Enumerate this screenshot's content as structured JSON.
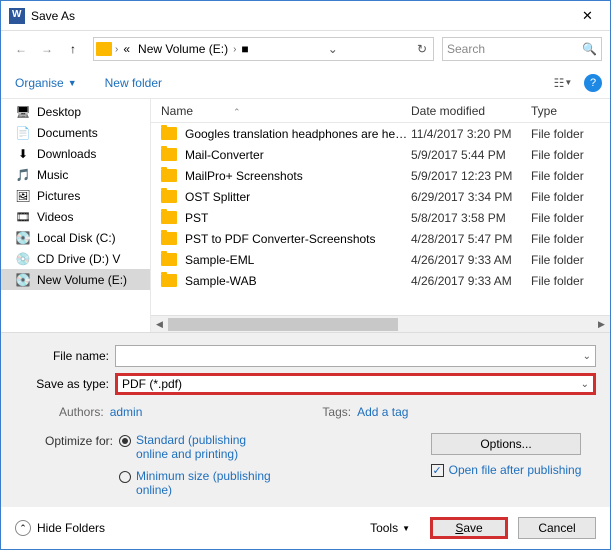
{
  "title": "Save As",
  "nav": {
    "back": "←",
    "fwd": "→",
    "up": "↑"
  },
  "breadcrumb": {
    "root": "«",
    "folder": "New Volume (E:)",
    "sub": "▸"
  },
  "search": {
    "placeholder": "Search"
  },
  "toolbar": {
    "organise": "Organise",
    "newfolder": "New folder",
    "help": "?"
  },
  "tree": [
    {
      "icon": "🖥",
      "label": "Desktop"
    },
    {
      "icon": "📄",
      "label": "Documents"
    },
    {
      "icon": "⬇",
      "label": "Downloads"
    },
    {
      "icon": "🎵",
      "label": "Music"
    },
    {
      "icon": "🖼",
      "label": "Pictures"
    },
    {
      "icon": "🎞",
      "label": "Videos"
    },
    {
      "icon": "💽",
      "label": "Local Disk (C:)"
    },
    {
      "icon": "💿",
      "label": "CD Drive (D:) V"
    },
    {
      "icon": "💽",
      "label": "New Volume (E:)",
      "sel": true
    }
  ],
  "columns": {
    "name": "Name",
    "date": "Date modified",
    "type": "Type"
  },
  "rows": [
    {
      "name": "Googles translation headphones are here...",
      "date": "11/4/2017 3:20 PM",
      "type": "File folder"
    },
    {
      "name": "Mail-Converter",
      "date": "5/9/2017 5:44 PM",
      "type": "File folder"
    },
    {
      "name": "MailPro+ Screenshots",
      "date": "5/9/2017 12:23 PM",
      "type": "File folder"
    },
    {
      "name": "OST Splitter",
      "date": "6/29/2017 3:34 PM",
      "type": "File folder"
    },
    {
      "name": "PST",
      "date": "5/8/2017 3:58 PM",
      "type": "File folder"
    },
    {
      "name": "PST to PDF Converter-Screenshots",
      "date": "4/28/2017 5:47 PM",
      "type": "File folder"
    },
    {
      "name": "Sample-EML",
      "date": "4/26/2017 9:33 AM",
      "type": "File folder"
    },
    {
      "name": "Sample-WAB",
      "date": "4/26/2017 9:33 AM",
      "type": "File folder"
    }
  ],
  "filename_label": "File name:",
  "filename_value": "",
  "saveastype_label": "Save as type:",
  "saveastype_value": "PDF (*.pdf)",
  "authors_label": "Authors:",
  "authors_value": "admin",
  "tags_label": "Tags:",
  "tags_value": "Add a tag",
  "optimize_label": "Optimize for:",
  "opt_standard": "Standard (publishing online and printing)",
  "opt_min": "Minimum size (publishing online)",
  "options_btn": "Options...",
  "openafter": "Open file after publishing",
  "hidefolders": "Hide Folders",
  "tools": "Tools",
  "save": "Save",
  "cancel": "Cancel"
}
